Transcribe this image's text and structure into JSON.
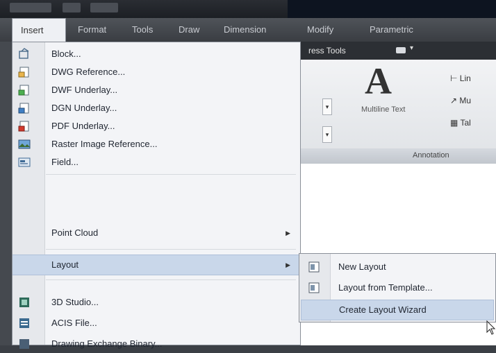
{
  "menubar": {
    "items": [
      "Insert",
      "Format",
      "Tools",
      "Draw",
      "Dimension",
      "Modify",
      "Parametric"
    ]
  },
  "ribbon": {
    "tab_label": "ress Tools",
    "multiline_text": "Multiline Text",
    "annotation_panel": "Annotation",
    "small_items": [
      "Lin",
      "Mu",
      "Tal"
    ]
  },
  "insert_menu": {
    "items": [
      {
        "label": "Block...",
        "icon": "block-icon"
      },
      {
        "label": "DWG Reference...",
        "icon": "dwg-reference-icon"
      },
      {
        "label": "DWF Underlay...",
        "icon": "dwf-underlay-icon"
      },
      {
        "label": "DGN Underlay...",
        "icon": "dgn-underlay-icon"
      },
      {
        "label": "PDF Underlay...",
        "icon": "pdf-underlay-icon"
      },
      {
        "label": "Raster Image Reference...",
        "icon": "raster-image-icon"
      },
      {
        "label": "Field...",
        "icon": "field-icon"
      },
      {
        "label": "Point Cloud",
        "icon": ""
      },
      {
        "label": "Layout",
        "icon": ""
      },
      {
        "label": "3D Studio...",
        "icon": "3d-studio-icon"
      },
      {
        "label": "ACIS File...",
        "icon": "acis-file-icon"
      },
      {
        "label": "Drawing Exchange Binary...",
        "icon": "dxb-icon"
      }
    ]
  },
  "layout_submenu": {
    "items": [
      {
        "label": "New Layout",
        "icon": "new-layout-icon"
      },
      {
        "label": "Layout from Template...",
        "icon": "layout-template-icon"
      },
      {
        "label": "Create Layout Wizard",
        "icon": ""
      }
    ]
  },
  "colors": {
    "menu_bg": "#f3f4f7",
    "highlight": "#c9d7ea",
    "menubar_bg": "#3a3d42"
  }
}
